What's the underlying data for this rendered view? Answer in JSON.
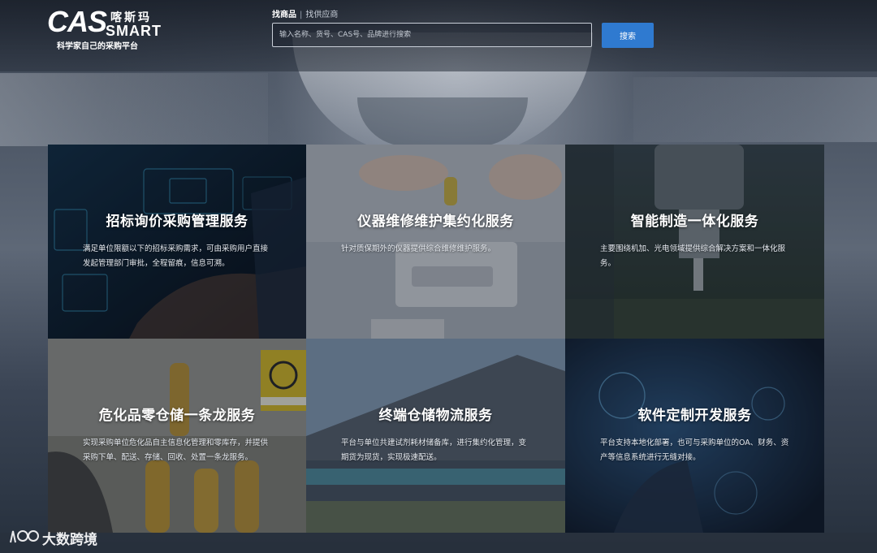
{
  "header": {
    "logo": {
      "brand": "CAS",
      "chinese_name": "喀斯玛",
      "smart": "SMART",
      "tagline": "科学家自己的采购平台"
    },
    "search": {
      "tabs": [
        {
          "label": "找商品",
          "active": true
        },
        {
          "label": "找供应商",
          "active": false
        }
      ],
      "separator": "|",
      "placeholder": "输入名称、货号、CAS号、品牌进行搜索",
      "value": "",
      "button_label": "搜索"
    }
  },
  "services": [
    {
      "title": "招标询价采购管理服务",
      "description": "满足单位限额以下的招标采购需求，可由采购用户直接发起管理部门审批，全程留痕，信息可溯。"
    },
    {
      "title": "仪器维修维护集约化服务",
      "description": "针对质保期外的仪器提供综合维修维护服务。"
    },
    {
      "title": "智能制造一体化服务",
      "description": "主要围绕机加、光电领域提供综合解决方案和一体化服务。"
    },
    {
      "title": "危化品零仓储一条龙服务",
      "description": "实现采购单位危化品自主信息化管理和零库存，并提供采购下单、配送、存储、回收、处置一条龙服务。"
    },
    {
      "title": "终端仓储物流服务",
      "description": "平台与单位共建试剂耗材储备库，进行集约化管理，变期货为现货，实现极速配送。"
    },
    {
      "title": "软件定制开发服务",
      "description": "平台支持本地化部署，也可与采购单位的OA、财务、资产等信息系统进行无缝对接。"
    }
  ],
  "watermark": {
    "text": "大数跨境"
  },
  "colors": {
    "accent": "#2f7ad0",
    "text": "#ffffff"
  }
}
